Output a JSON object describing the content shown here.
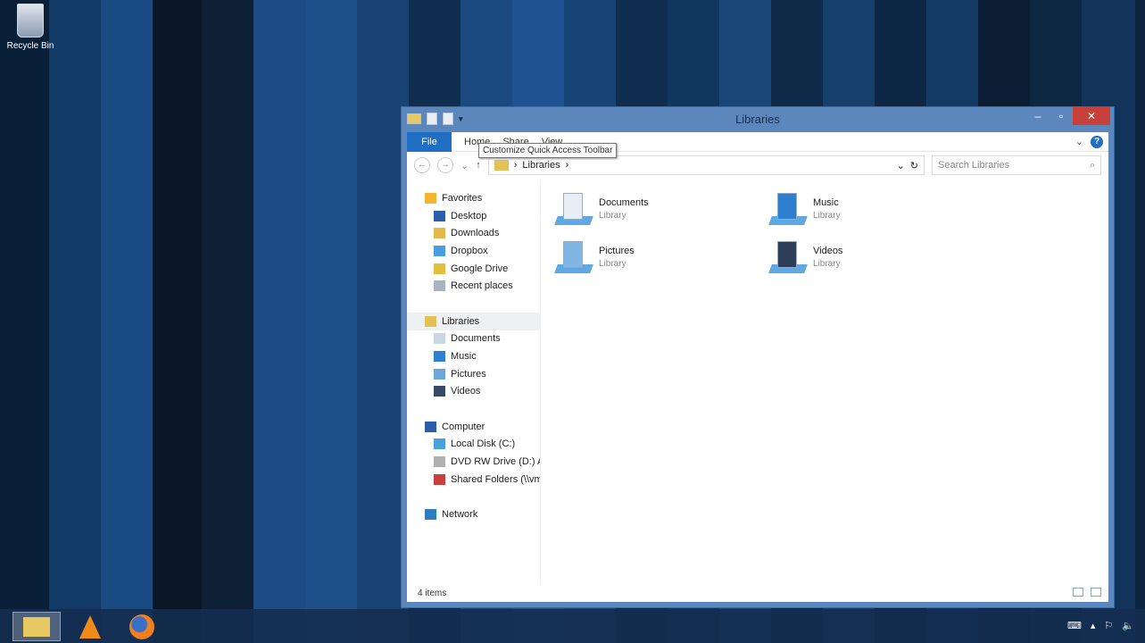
{
  "desktop": {
    "icons": [
      {
        "label": "Recycle Bin"
      }
    ]
  },
  "window": {
    "title": "Libraries",
    "ribbon": {
      "file": "File",
      "tabs": [
        "Home",
        "Share",
        "View"
      ],
      "help": "?"
    },
    "tooltip": "Customize Quick Access Toolbar",
    "address": {
      "crumbs": [
        "Libraries"
      ]
    },
    "search_placeholder": "Search Libraries",
    "nav": [
      {
        "label": "Favorites",
        "type": "head",
        "color": "#f2b632"
      },
      {
        "label": "Desktop",
        "type": "sub",
        "color": "#2c5fa8"
      },
      {
        "label": "Downloads",
        "type": "sub",
        "color": "#e3b94a"
      },
      {
        "label": "Dropbox",
        "type": "sub",
        "color": "#4a9de0"
      },
      {
        "label": "Google Drive",
        "type": "sub",
        "color": "#e1c040"
      },
      {
        "label": "Recent places",
        "type": "sub",
        "color": "#a8b4c0"
      },
      {
        "type": "gap"
      },
      {
        "label": "Libraries",
        "type": "head",
        "selected": true,
        "color": "#e2c256"
      },
      {
        "label": "Documents",
        "type": "sub",
        "color": "#c9d6e4"
      },
      {
        "label": "Music",
        "type": "sub",
        "color": "#2f7fd0"
      },
      {
        "label": "Pictures",
        "type": "sub",
        "color": "#6fa6d8"
      },
      {
        "label": "Videos",
        "type": "sub",
        "color": "#344a66"
      },
      {
        "type": "gap"
      },
      {
        "label": "Computer",
        "type": "head",
        "color": "#2e5ea8"
      },
      {
        "label": "Local Disk (C:)",
        "type": "sub",
        "color": "#4aa0d8"
      },
      {
        "label": "DVD RW Drive (D:) A",
        "type": "sub",
        "color": "#b0b0b0"
      },
      {
        "label": "Shared Folders (\\\\vm",
        "type": "sub",
        "color": "#c84040"
      },
      {
        "type": "gap"
      },
      {
        "label": "Network",
        "type": "head",
        "color": "#2e7fc0"
      }
    ],
    "items": [
      {
        "name": "Documents",
        "kind": "Library"
      },
      {
        "name": "Music",
        "kind": "Library"
      },
      {
        "name": "Pictures",
        "kind": "Library"
      },
      {
        "name": "Videos",
        "kind": "Library"
      }
    ],
    "status": "4 items"
  },
  "taskbar": {
    "apps": [
      "File Explorer",
      "VLC",
      "Firefox"
    ]
  }
}
